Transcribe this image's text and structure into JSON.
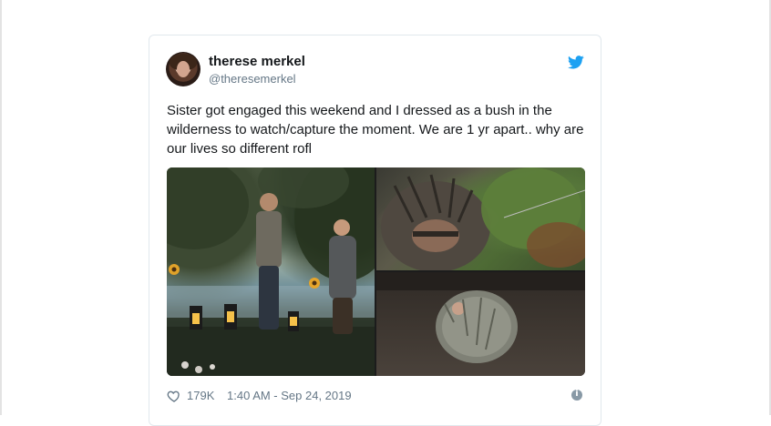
{
  "tweet": {
    "author": {
      "display_name": "therese merkel",
      "handle": "@theresemerkel"
    },
    "text": "Sister got engaged this weekend and I dressed as a bush in the wilderness to watch/capture the moment. We are 1 yr apart.. why are our lives so different rofl",
    "likes": "179K",
    "timestamp": "1:40 AM - Sep 24, 2019",
    "photos": [
      {
        "name": "proposal-photo",
        "description": "couple proposal at lakeside with sunflowers and lanterns"
      },
      {
        "name": "ghillie-closeup-photo",
        "description": "person in ghillie suit hiding in bushes"
      },
      {
        "name": "ghillie-ground-photo",
        "description": "person in ghillie suit crouched on dirt ground"
      }
    ],
    "icons": [
      "avatar",
      "twitter-bird-icon",
      "heart-icon",
      "info-icon"
    ]
  },
  "colors": {
    "brand": "#1da1f2",
    "text": "#14171a",
    "secondary": "#657786",
    "border": "#e1e8ed"
  }
}
